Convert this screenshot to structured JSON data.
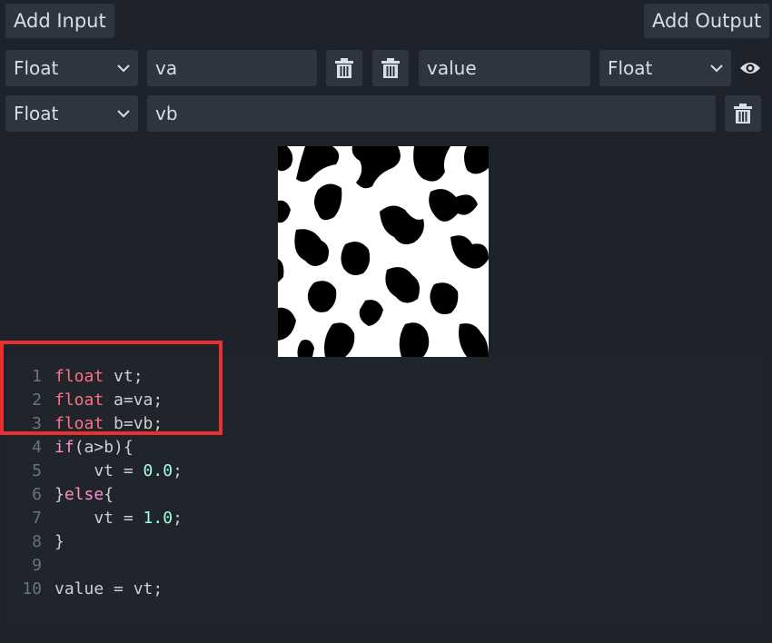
{
  "toolbar": {
    "add_input_label": "Add Input",
    "add_output_label": "Add Output"
  },
  "inputs": [
    {
      "type": "Float",
      "name": "va"
    },
    {
      "type": "Float",
      "name": "vb"
    }
  ],
  "outputs": [
    {
      "type": "Float",
      "name": "value"
    }
  ],
  "code": {
    "lines": [
      {
        "num": "1",
        "t1": "float",
        "t2": " vt;"
      },
      {
        "num": "2",
        "t1": "float",
        "t2": " a=va;"
      },
      {
        "num": "3",
        "t1": "float",
        "t2": " b=vb;"
      },
      {
        "num": "4",
        "t1": "if",
        "t2": "(a>b){"
      },
      {
        "num": "5",
        "t1": "    vt = ",
        "t2": "0.0",
        "t3": ";"
      },
      {
        "num": "6",
        "t1": "}",
        "t2": "else",
        "t3": "{"
      },
      {
        "num": "7",
        "t1": "    vt = ",
        "t2": "1.0",
        "t3": ";"
      },
      {
        "num": "8",
        "t1": "}"
      },
      {
        "num": "9"
      },
      {
        "num": "10",
        "t1": "value = vt;"
      }
    ]
  },
  "colors": {
    "background": "#1e222a",
    "control": "#2f3441",
    "highlight_box": "#e8302f"
  },
  "icons": {
    "delete": "trash-icon",
    "visibility": "eye-icon",
    "dropdown": "chevron-down-icon"
  }
}
